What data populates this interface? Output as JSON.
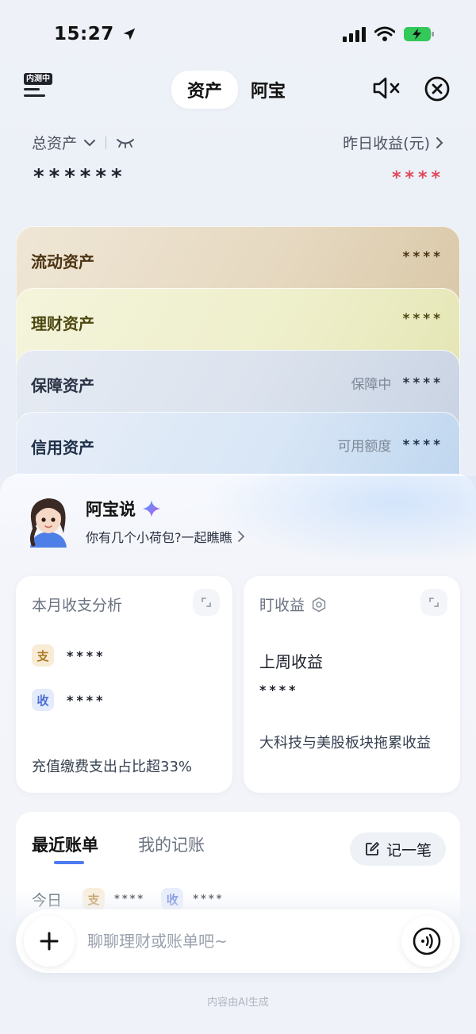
{
  "status_bar": {
    "time": "15:27"
  },
  "header": {
    "beta_badge": "内测中",
    "tabs": [
      {
        "label": "资产",
        "active": true
      },
      {
        "label": "阿宝",
        "active": false
      }
    ]
  },
  "summary": {
    "total_label": "总资产",
    "total_value": "******",
    "yesterday_label": "昨日收益(元)",
    "yesterday_value": "****"
  },
  "asset_cards": [
    {
      "name": "流动资产",
      "sub": "",
      "value": "****"
    },
    {
      "name": "理财资产",
      "sub": "",
      "value": "****"
    },
    {
      "name": "保障资产",
      "sub": "保障中",
      "value": "****"
    },
    {
      "name": "信用资产",
      "sub": "可用额度",
      "value": "****"
    }
  ],
  "assistant": {
    "title": "阿宝说",
    "subtitle": "你有几个小荷包?一起瞧瞧"
  },
  "monthly": {
    "title": "本月收支分析",
    "expense_tag": "支",
    "expense_value": "****",
    "income_tag": "收",
    "income_value": "****",
    "footer": "充值缴费支出占比超33%"
  },
  "earnings": {
    "title": "盯收益",
    "subtitle": "上周收益",
    "value": "****",
    "footer": "大科技与美股板块拖累收益"
  },
  "bills": {
    "tab_recent": "最近账单",
    "tab_mine": "我的记账",
    "record_label": "记一笔",
    "today_label": "今日",
    "expense_tag": "支",
    "expense_value": "****",
    "income_tag": "收",
    "income_value": "****"
  },
  "chat": {
    "placeholder": "聊聊理财或账单吧~"
  },
  "footer_note": "内容由AI生成",
  "colors": {
    "accent": "#4d7af0",
    "gain_red": "#e0495b",
    "battery_green": "#34c759"
  }
}
